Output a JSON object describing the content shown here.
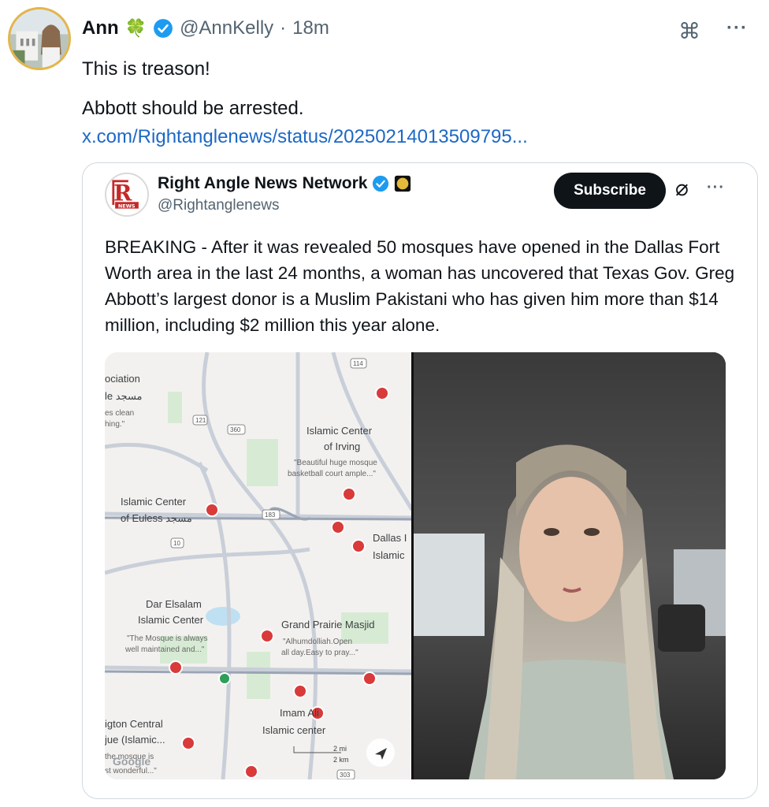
{
  "tweet": {
    "author_name": "Ann",
    "author_emoji": "🍀",
    "handle": "@AnnKelly",
    "separator": "·",
    "time": "18m",
    "text_line1": "This is treason!",
    "text_line2": "Abbott should be arrested.",
    "link": "x.com/Rightanglenews/status/20250214013509795..."
  },
  "quote": {
    "author_name": "Right Angle News Network",
    "handle": "@Rightanglenews",
    "subscribe_label": "Subscribe",
    "body": "BREAKING - After it was revealed 50 mosques have opened in the Dallas Fort Worth area in the last 24 months, a woman has uncovered that Texas Gov. Greg Abbott’s largest donor is a Muslim Pakistani who has given him more than $14 million, including $2 million this year alone."
  },
  "map_labels": {
    "ociation": "ociation",
    "le": "le مسجد",
    "clean": "es clean",
    "hing": "hing.\"",
    "islamic_center_irving_1": "Islamic Center",
    "islamic_center_irving_2": "of Irving",
    "irving_review_1": "\"Beautiful huge mosque",
    "irving_review_2": "basketball court ample...\"",
    "euless_1": "Islamic Center",
    "euless_2": "of Euless مسجد",
    "dallas_1": "Dallas I",
    "dallas_2": "Islamic",
    "dar_1": "Dar Elsalam",
    "dar_2": "Islamic Center",
    "dar_review_1": "\"The Mosque is always",
    "dar_review_2": "well maintained and...\"",
    "gp_1": "Grand Prairie Masjid",
    "gp_review_1": "\"Alhumdolliah.Open",
    "gp_review_2": "all day.Easy to pray...\"",
    "imam_1": "Imam Ali",
    "imam_2": "Islamic center",
    "arlington_1": "igton Central",
    "arlington_2": "jue (Islamic...",
    "arlington_3": "the mosque is",
    "arlington_4": "st wonderful...\"",
    "google": "Google",
    "scale_mi": "2 mi",
    "scale_km": "2 km",
    "hw_114": "114",
    "hw_121": "121",
    "hw_360": "360",
    "hw_183": "183",
    "hw_10": "10",
    "hw_303": "303"
  },
  "icons": {
    "grok": "⌘",
    "more": "···",
    "grok_quote": "⌀"
  },
  "colors": {
    "link": "#1d68c6",
    "verified": "#1d9bf0",
    "avatar_ring": "#e3b64a",
    "map_pin": "#d93a3a"
  }
}
